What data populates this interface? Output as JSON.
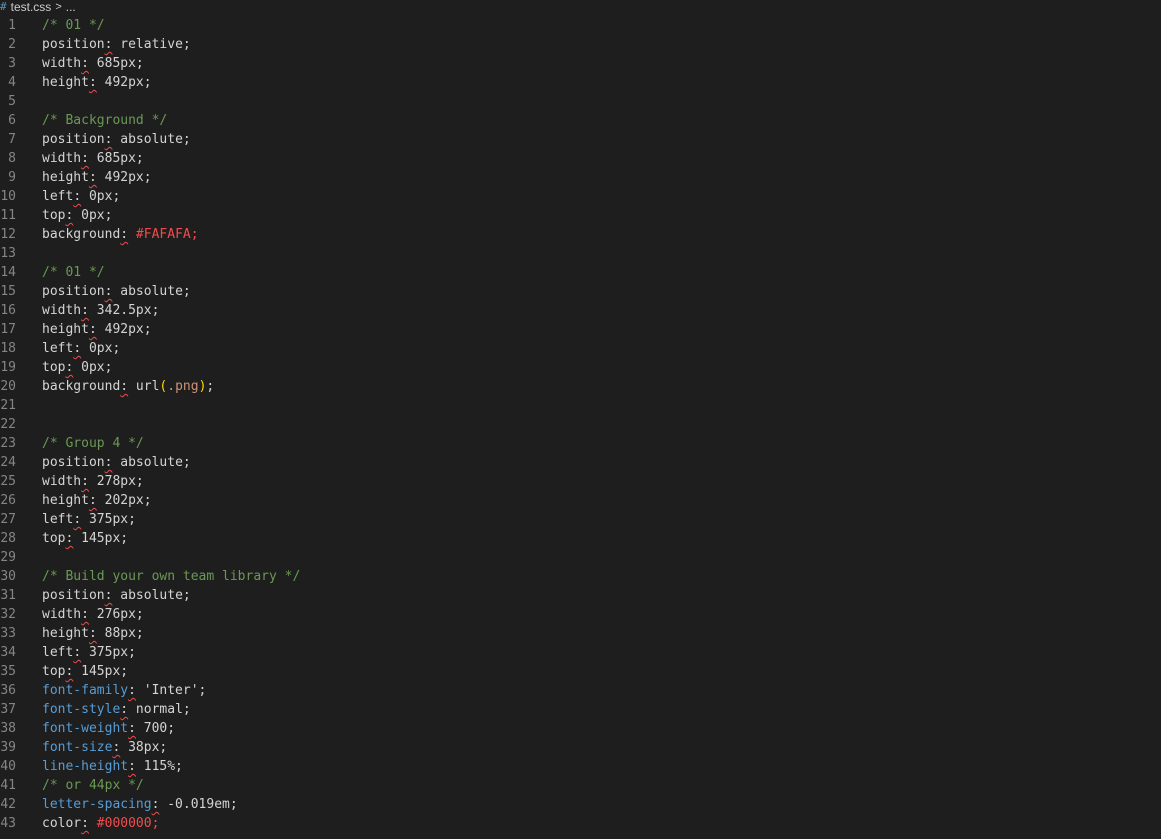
{
  "breadcrumb": {
    "icon": "#",
    "file": "test.css",
    "separator": ">",
    "ellipsis": "..."
  },
  "lines": [
    {
      "n": "1",
      "kind": "comment",
      "text": "/* 01 */"
    },
    {
      "n": "2",
      "kind": "decl",
      "prop": "position",
      "val": " relative;"
    },
    {
      "n": "3",
      "kind": "decl",
      "prop": "width",
      "val": " 685px;"
    },
    {
      "n": "4",
      "kind": "decl",
      "prop": "height",
      "val": " 492px;"
    },
    {
      "n": "5",
      "kind": "empty"
    },
    {
      "n": "6",
      "kind": "comment",
      "text": "/* Background */"
    },
    {
      "n": "7",
      "kind": "decl",
      "prop": "position",
      "val": " absolute;"
    },
    {
      "n": "8",
      "kind": "decl",
      "prop": "width",
      "val": " 685px;"
    },
    {
      "n": "9",
      "kind": "decl",
      "prop": "height",
      "val": " 492px;"
    },
    {
      "n": "10",
      "kind": "decl",
      "prop": "left",
      "val": " 0px;"
    },
    {
      "n": "11",
      "kind": "decl",
      "prop": "top",
      "val": " 0px;"
    },
    {
      "n": "12",
      "kind": "hex",
      "prop": "background",
      "val": " #FAFAFA;"
    },
    {
      "n": "13",
      "kind": "empty"
    },
    {
      "n": "14",
      "kind": "comment",
      "text": "/* 01 */"
    },
    {
      "n": "15",
      "kind": "decl",
      "prop": "position",
      "val": " absolute;"
    },
    {
      "n": "16",
      "kind": "decl",
      "prop": "width",
      "val": " 342.5px;"
    },
    {
      "n": "17",
      "kind": "decl",
      "prop": "height",
      "val": " 492px;"
    },
    {
      "n": "18",
      "kind": "decl",
      "prop": "left",
      "val": " 0px;"
    },
    {
      "n": "19",
      "kind": "decl",
      "prop": "top",
      "val": " 0px;"
    },
    {
      "n": "20",
      "kind": "url",
      "prop": "background",
      "fn": " url",
      "open": "(",
      "arg": ".png",
      "close": ")",
      "tail": ";"
    },
    {
      "n": "21",
      "kind": "empty"
    },
    {
      "n": "22",
      "kind": "empty"
    },
    {
      "n": "23",
      "kind": "comment",
      "text": "/* Group 4 */"
    },
    {
      "n": "24",
      "kind": "decl",
      "prop": "position",
      "val": " absolute;"
    },
    {
      "n": "25",
      "kind": "decl",
      "prop": "width",
      "val": " 278px;"
    },
    {
      "n": "26",
      "kind": "decl",
      "prop": "height",
      "val": " 202px;"
    },
    {
      "n": "27",
      "kind": "decl",
      "prop": "left",
      "val": " 375px;"
    },
    {
      "n": "28",
      "kind": "decl",
      "prop": "top",
      "val": " 145px;"
    },
    {
      "n": "29",
      "kind": "empty"
    },
    {
      "n": "30",
      "kind": "comment",
      "text": "/* Build your own team library */"
    },
    {
      "n": "31",
      "kind": "decl",
      "prop": "position",
      "val": " absolute;"
    },
    {
      "n": "32",
      "kind": "decl",
      "prop": "width",
      "val": " 276px;"
    },
    {
      "n": "33",
      "kind": "decl",
      "prop": "height",
      "val": " 88px;"
    },
    {
      "n": "34",
      "kind": "decl",
      "prop": "left",
      "val": " 375px;"
    },
    {
      "n": "35",
      "kind": "decl",
      "prop": "top",
      "val": " 145px;"
    },
    {
      "n": "36",
      "kind": "declb",
      "prop": "font-family",
      "val": " 'Inter';"
    },
    {
      "n": "37",
      "kind": "declb",
      "prop": "font-style",
      "val": " normal;"
    },
    {
      "n": "38",
      "kind": "declb",
      "prop": "font-weight",
      "val": " 700;"
    },
    {
      "n": "39",
      "kind": "declb",
      "prop": "font-size",
      "val": " 38px;"
    },
    {
      "n": "40",
      "kind": "declb",
      "prop": "line-height",
      "val": " 115%;"
    },
    {
      "n": "41",
      "kind": "comment",
      "text": "/* or 44px */"
    },
    {
      "n": "42",
      "kind": "declb",
      "prop": "letter-spacing",
      "val": " -0.019em;"
    },
    {
      "n": "43",
      "kind": "hex",
      "prop": "color",
      "val": " #000000;"
    }
  ],
  "colors": {
    "background": "#1e1e1e",
    "line_number": "#858585",
    "comment": "#6a9955",
    "property_blue": "#569cd6",
    "hex_value": "#f14c4c",
    "squiggle": "#f14c4c",
    "bracket": "#ffd700",
    "file_icon": "#519aba"
  }
}
